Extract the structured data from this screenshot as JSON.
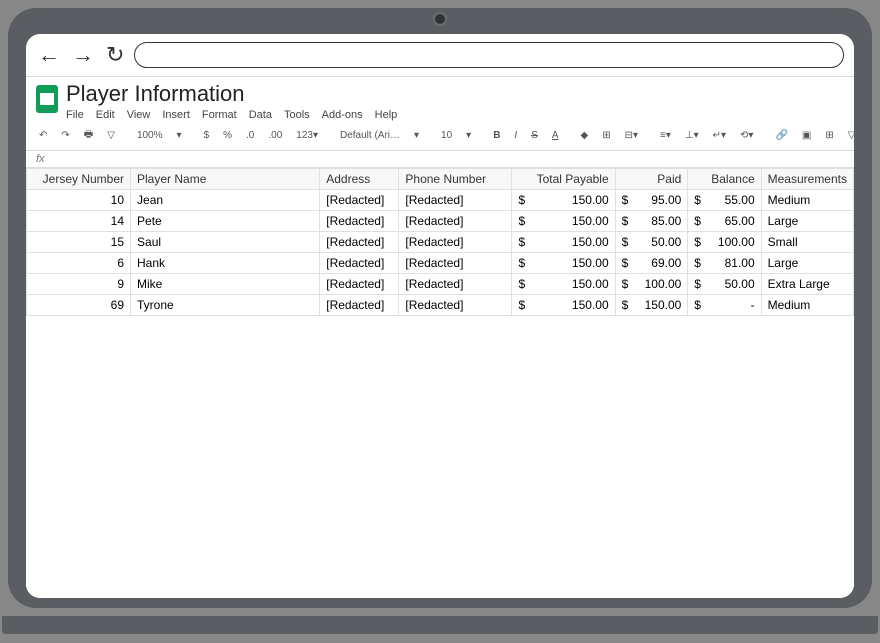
{
  "doc": {
    "title": "Player Information"
  },
  "menu": [
    "File",
    "Edit",
    "View",
    "Insert",
    "Format",
    "Data",
    "Tools",
    "Add-ons",
    "Help"
  ],
  "toolbar": {
    "zoom": "100%",
    "font": "Default (Ari…",
    "size": "10"
  },
  "formula_bar": {
    "fx": "fx"
  },
  "table": {
    "headers": [
      "Jersey Number",
      "Player Name",
      "Address",
      "Phone Number",
      "Total Payable",
      "Paid",
      "Balance",
      "Measurements"
    ],
    "rows": [
      {
        "jersey": "10",
        "name": "Jean",
        "address": "[Redacted]",
        "phone": "[Redacted]",
        "payable": "150.00",
        "paid": "95.00",
        "balance": "55.00",
        "meas": "Medium"
      },
      {
        "jersey": "14",
        "name": "Pete",
        "address": "[Redacted]",
        "phone": "[Redacted]",
        "payable": "150.00",
        "paid": "85.00",
        "balance": "65.00",
        "meas": "Large"
      },
      {
        "jersey": "15",
        "name": "Saul",
        "address": "[Redacted]",
        "phone": "[Redacted]",
        "payable": "150.00",
        "paid": "50.00",
        "balance": "100.00",
        "meas": "Small"
      },
      {
        "jersey": "6",
        "name": "Hank",
        "address": "[Redacted]",
        "phone": "[Redacted]",
        "payable": "150.00",
        "paid": "69.00",
        "balance": "81.00",
        "meas": "Large"
      },
      {
        "jersey": "9",
        "name": "Mike",
        "address": "[Redacted]",
        "phone": "[Redacted]",
        "payable": "150.00",
        "paid": "100.00",
        "balance": "50.00",
        "meas": "Extra Large"
      },
      {
        "jersey": "69",
        "name": "Tyrone",
        "address": "[Redacted]",
        "phone": "[Redacted]",
        "payable": "150.00",
        "paid": "150.00",
        "balance": "-",
        "meas": "Medium"
      }
    ]
  },
  "currency": "$"
}
